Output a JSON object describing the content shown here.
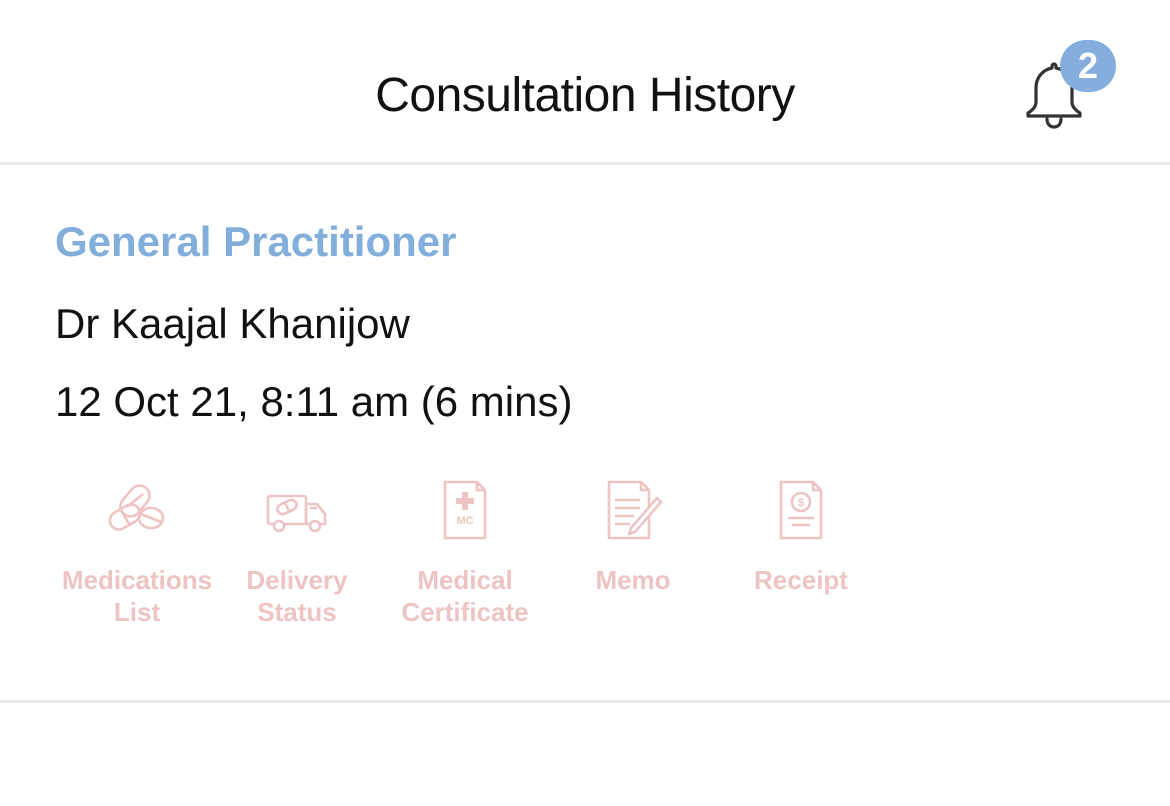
{
  "header": {
    "title": "Consultation History",
    "notification_count": "2"
  },
  "consultation": {
    "specialty": "General Practitioner",
    "doctor": "Dr Kaajal Khanijow",
    "datetime": "12 Oct 21, 8:11 am (6 mins)",
    "actions": [
      {
        "label": "Medications\nList",
        "icon": "pills-icon"
      },
      {
        "label": "Delivery\nStatus",
        "icon": "delivery-truck-icon"
      },
      {
        "label": "Medical\nCertificate",
        "icon": "medical-certificate-icon"
      },
      {
        "label": "Memo",
        "icon": "memo-icon"
      },
      {
        "label": "Receipt",
        "icon": "receipt-icon"
      }
    ]
  },
  "colors": {
    "accent_blue": "#82aedb",
    "badge_blue": "#85aede",
    "action_pink": "#eec3c3"
  }
}
